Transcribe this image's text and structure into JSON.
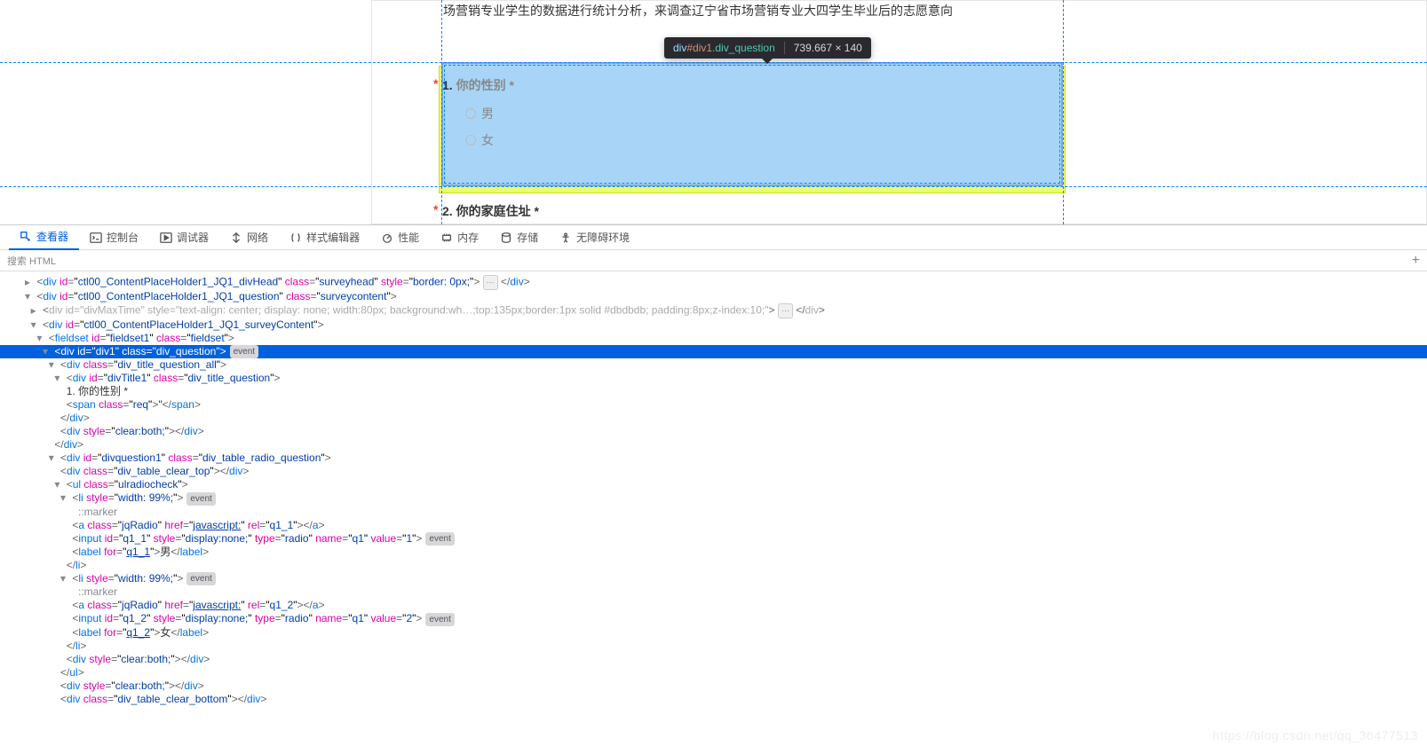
{
  "viewport": {
    "intro": "场营销专业学生的数据进行统计分析，来调查辽宁省市场营销专业大四学生毕业后的志愿意向",
    "tooltip": {
      "tag": "div",
      "id": "#div1",
      "cls": ".div_question",
      "dim": "739.667 × 140"
    },
    "q1": {
      "star": "*",
      "num": "1.",
      "title": "你的性别 *",
      "opt1": "男",
      "opt2": "女"
    },
    "q2": {
      "star": "*",
      "num": "2.",
      "title": "你的家庭住址 *"
    }
  },
  "devtools": {
    "tabs": {
      "inspector": "查看器",
      "console": "控制台",
      "debugger": "调试器",
      "network": "网络",
      "style": "样式编辑器",
      "perf": "性能",
      "memory": "内存",
      "storage": "存储",
      "a11y": "无障碍环境"
    },
    "search": "搜索 HTML",
    "dom": {
      "l1": {
        "i": "      ▸ ",
        "open": "<",
        "tag": "div",
        "a1": "id",
        "v1": "ctl00_ContentPlaceHolder1_JQ1_divHead",
        "a2": "class",
        "v2": "surveyhead",
        "a3": "style",
        "v3": "border: 0px;",
        "close": ">",
        "end": "</div>"
      },
      "l2": {
        "i": "      ▾ ",
        "open": "<",
        "tag": "div",
        "a1": "id",
        "v1": "ctl00_ContentPlaceHolder1_JQ1_question",
        "a2": "class",
        "v2": "surveycontent",
        "close": ">"
      },
      "l3": {
        "i": "        ▸ ",
        "open": "<",
        "tag": "div",
        "a1": "id",
        "v1": "divMaxTime",
        "a2": "style",
        "v2": "text-align: center; display: none; width:80px; background:wh…;top:135px;border:1px solid #dbdbdb; padding:8px;z-index:10;",
        "close": ">",
        "end": "</div>"
      },
      "l4": {
        "i": "        ▾ ",
        "open": "<",
        "tag": "div",
        "a1": "id",
        "v1": "ctl00_ContentPlaceHolder1_JQ1_surveyContent",
        "close": ">"
      },
      "l5": {
        "i": "          ▾ ",
        "open": "<",
        "tag": "fieldset",
        "a1": "id",
        "v1": "fieldset1",
        "a2": "class",
        "v2": "fieldset",
        "close": ">"
      },
      "l6": {
        "i": "            ▾ ",
        "open": "<",
        "tag": "div",
        "a1": "id",
        "v1": "div1",
        "a2": "class",
        "v2": "div_question",
        "close": ">",
        "badge": "event"
      },
      "l7": {
        "i": "              ▾ ",
        "open": "<",
        "tag": "div",
        "a1": "class",
        "v1": "div_title_question_all",
        "close": ">"
      },
      "l8": {
        "i": "                ▾ ",
        "open": "<",
        "tag": "div",
        "a1": "id",
        "v1": "divTitle1",
        "a2": "class",
        "v2": "div_title_question",
        "close": ">"
      },
      "l9": {
        "i": "                    ",
        "text": "1. 你的性别 *"
      },
      "l10": {
        "i": "                    ",
        "open": "<",
        "tag": "span",
        "a1": "class",
        "v1": "req",
        "close": ">",
        "end": "</span>"
      },
      "l11": {
        "i": "                  ",
        "close": "</",
        "tag": "div",
        "end": ">"
      },
      "l12": {
        "i": "                  ",
        "open": "<",
        "tag": "div",
        "a1": "style",
        "v1": "clear:both;",
        "close": ">",
        "end": "</div>"
      },
      "l13": {
        "i": "                ",
        "close": "</",
        "tag": "div",
        "end": ">"
      },
      "l14": {
        "i": "              ▾ ",
        "open": "<",
        "tag": "div",
        "a1": "id",
        "v1": "divquestion1",
        "a2": "class",
        "v2": "div_table_radio_question",
        "close": ">"
      },
      "l15": {
        "i": "                  ",
        "open": "<",
        "tag": "div",
        "a1": "class",
        "v1": "div_table_clear_top",
        "close": ">",
        "end": "</div>"
      },
      "l16": {
        "i": "                ▾ ",
        "open": "<",
        "tag": "ul",
        "a1": "class",
        "v1": "ulradiocheck",
        "close": ">"
      },
      "l17": {
        "i": "                  ▾ ",
        "open": "<",
        "tag": "li",
        "a1": "style",
        "v1": "width: 99%;",
        "close": ">",
        "badge": "event"
      },
      "l18": {
        "i": "                        ",
        "text": "::marker"
      },
      "l19": {
        "i": "                      ",
        "open": "<",
        "tag": "a",
        "a1": "class",
        "v1": "jqRadio",
        "a2": "href",
        "v2": "javascript:",
        "a3": "rel",
        "v3": "q1_1",
        "close": ">",
        "end": "</a>"
      },
      "l20": {
        "i": "                      ",
        "open": "<",
        "tag": "input",
        "a1": "id",
        "v1": "q1_1",
        "a2": "style",
        "v2": "display:none;",
        "a3": "type",
        "v3": "radio",
        "a4": "name",
        "v4": "q1",
        "a5": "value",
        "v5": "1",
        "close": ">",
        "badge": "event"
      },
      "l21": {
        "i": "                      ",
        "open": "<",
        "tag": "label",
        "a1": "for",
        "v1": "q1_1",
        "close": ">",
        "text": "男",
        "end": "</label>"
      },
      "l22": {
        "i": "                    ",
        "close": "</",
        "tag": "li",
        "end": ">"
      },
      "l23": {
        "i": "                  ▾ ",
        "open": "<",
        "tag": "li",
        "a1": "style",
        "v1": "width: 99%;",
        "close": ">",
        "badge": "event"
      },
      "l24": {
        "i": "                        ",
        "text": "::marker"
      },
      "l25": {
        "i": "                      ",
        "open": "<",
        "tag": "a",
        "a1": "class",
        "v1": "jqRadio",
        "a2": "href",
        "v2": "javascript:",
        "a3": "rel",
        "v3": "q1_2",
        "close": ">",
        "end": "</a>"
      },
      "l26": {
        "i": "                      ",
        "open": "<",
        "tag": "input",
        "a1": "id",
        "v1": "q1_2",
        "a2": "style",
        "v2": "display:none;",
        "a3": "type",
        "v3": "radio",
        "a4": "name",
        "v4": "q1",
        "a5": "value",
        "v5": "2",
        "close": ">",
        "badge": "event"
      },
      "l27": {
        "i": "                      ",
        "open": "<",
        "tag": "label",
        "a1": "for",
        "v1": "q1_2",
        "close": ">",
        "text": "女",
        "end": "</label>"
      },
      "l28": {
        "i": "                    ",
        "close": "</",
        "tag": "li",
        "end": ">"
      },
      "l29": {
        "i": "                    ",
        "open": "<",
        "tag": "div",
        "a1": "style",
        "v1": "clear:both;",
        "close": ">",
        "end": "</div>"
      },
      "l30": {
        "i": "                  ",
        "close": "</",
        "tag": "ul",
        "end": ">"
      },
      "l31": {
        "i": "                  ",
        "open": "<",
        "tag": "div",
        "a1": "style",
        "v1": "clear:both;",
        "close": ">",
        "end": "</div>"
      },
      "l32": {
        "i": "                  ",
        "open": "<",
        "tag": "div",
        "a1": "class",
        "v1": "div_table_clear_bottom",
        "close": ">",
        "end": "</div>"
      }
    }
  },
  "watermark": "https://blog.csdn.net/qq_36477513"
}
